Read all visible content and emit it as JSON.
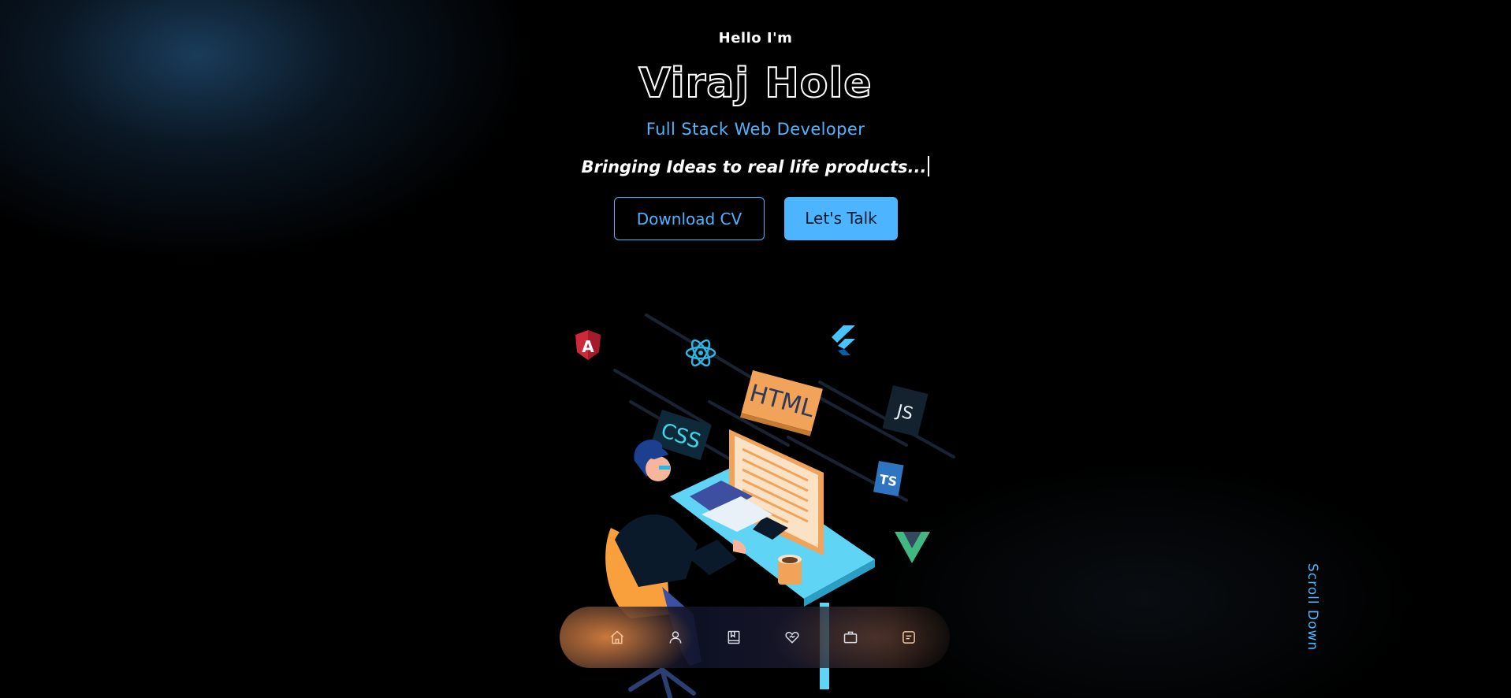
{
  "hero": {
    "greeting": "Hello I'm",
    "name": "Viraj Hole",
    "role": "Full Stack Web Developer",
    "tagline": "Bringing Ideas to real life products..."
  },
  "buttons": {
    "download_cv": "Download CV",
    "lets_talk": "Let's Talk"
  },
  "scroll_down": "Scroll Down",
  "illustration": {
    "labels": {
      "html": "HTML",
      "css": "CSS",
      "js": "JS",
      "ts": "TS"
    },
    "tech_icons": [
      "angular-icon",
      "react-icon",
      "flutter-icon",
      "html-icon",
      "css-icon",
      "js-icon",
      "ts-icon",
      "vue-icon"
    ]
  },
  "nav": {
    "items": [
      {
        "icon": "home-icon"
      },
      {
        "icon": "user-icon"
      },
      {
        "icon": "book-icon"
      },
      {
        "icon": "heart-hands-icon"
      },
      {
        "icon": "briefcase-icon"
      },
      {
        "icon": "message-icon"
      }
    ]
  },
  "colors": {
    "accent": "#4db5ff",
    "background": "#000000",
    "text": "#ffffff",
    "orange": "#ff9a3c"
  }
}
